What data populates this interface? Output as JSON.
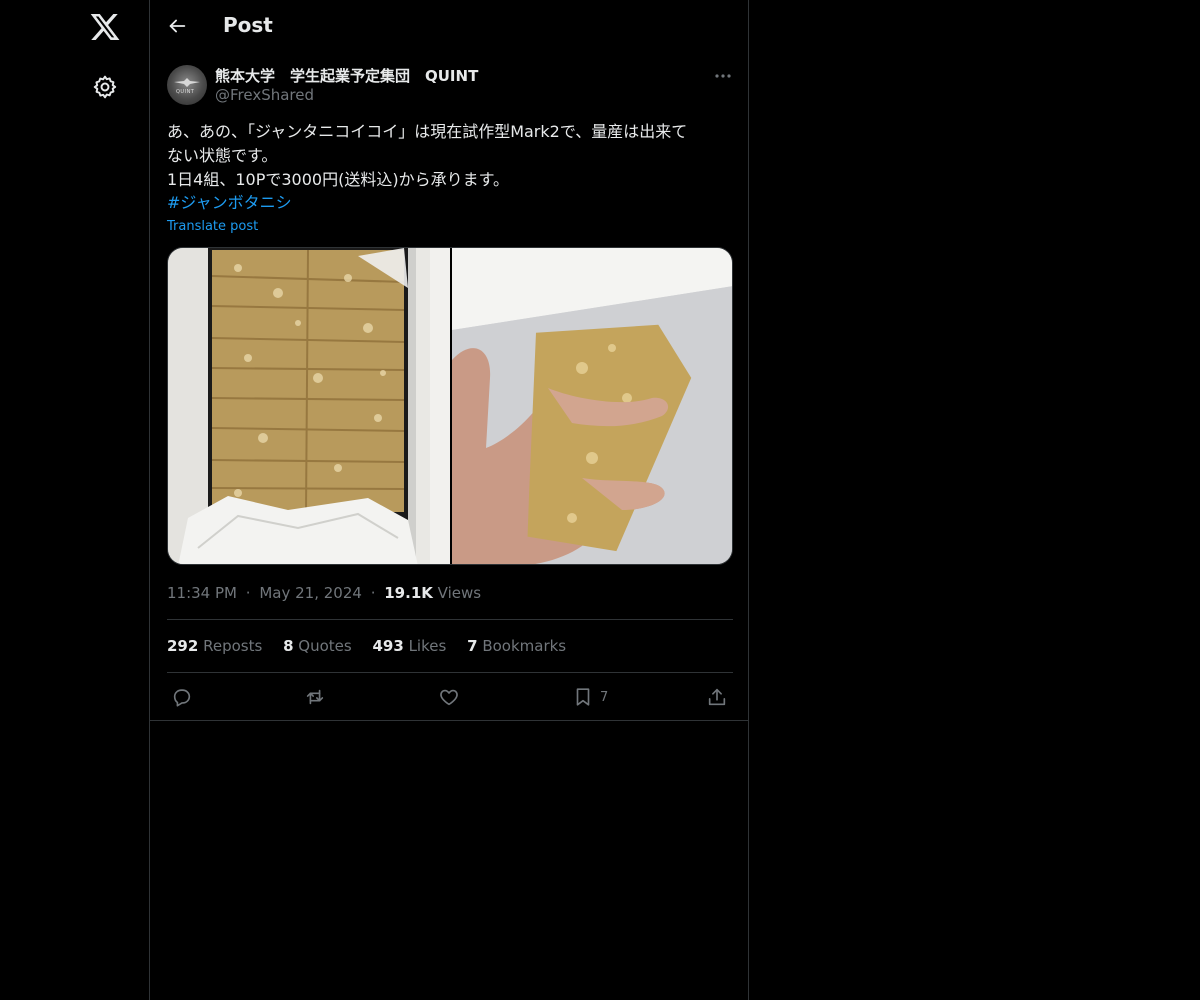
{
  "header": {
    "title": "Post"
  },
  "author": {
    "name": "熊本大学　学生起業予定集団　QUINT",
    "handle": "@FrexShared",
    "avatar_text": "QUINT"
  },
  "post": {
    "lines": [
      "あ、あの、「ジャンタニコイコイ」は現在試作型Mark2で、量産は出来て",
      "ない状態です。",
      "1日4組、10Pで3000円(送料込)から承ります。"
    ],
    "hashtag": "#ジャンボタニシ",
    "translate": "Translate post",
    "media": [
      {
        "description": "tray of baked bars",
        "icon": "photo"
      },
      {
        "description": "hand holding a bar",
        "icon": "photo"
      }
    ]
  },
  "meta": {
    "time": "11:34 PM",
    "date": "May 21, 2024",
    "sep": "·",
    "views_count": "19.1K",
    "views_label": "Views"
  },
  "stats": [
    {
      "count": "292",
      "label": "Reposts"
    },
    {
      "count": "8",
      "label": "Quotes"
    },
    {
      "count": "493",
      "label": "Likes"
    },
    {
      "count": "7",
      "label": "Bookmarks"
    }
  ],
  "actions": {
    "reply": {
      "icon": "reply-icon",
      "count": ""
    },
    "repost": {
      "icon": "repost-icon",
      "count": ""
    },
    "like": {
      "icon": "heart-icon",
      "count": ""
    },
    "bookmark": {
      "icon": "bookmark-icon",
      "count": "7"
    },
    "share": {
      "icon": "share-icon",
      "count": ""
    }
  },
  "colors": {
    "background": "#000000",
    "text": "#e7e9ea",
    "secondary": "#71767b",
    "accent": "#1d9bf0",
    "border": "#2f3336"
  }
}
